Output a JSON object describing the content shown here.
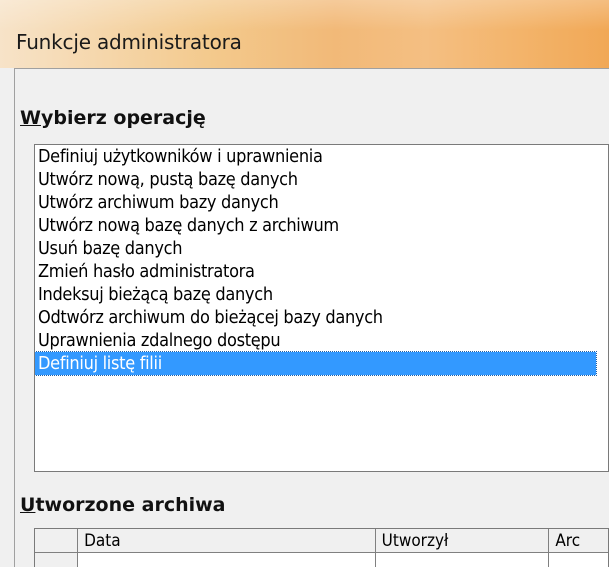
{
  "window": {
    "title": "Funkcje administratora"
  },
  "operations": {
    "label_mnemonic": "W",
    "label_rest": "ybierz operację",
    "items": [
      "Definiuj użytkowników i uprawnienia",
      "Utwórz nową, pustą bazę danych",
      "Utwórz archiwum bazy danych",
      "Utwórz nową bazę danych z archiwum",
      "Usuń bazę danych",
      "Zmień hasło administratora",
      "Indeksuj bieżącą bazę danych",
      "Odtwórz archiwum do bieżącej bazy danych",
      "Uprawnienia zdalnego dostępu",
      "Definiuj listę filii"
    ],
    "selected_index": 9,
    "selected_color": "#3399ff"
  },
  "archives": {
    "label_mnemonic": "U",
    "label_rest": "tworzone archiwa",
    "columns": [
      "",
      "Data",
      "Utworzył",
      "Arc"
    ]
  }
}
